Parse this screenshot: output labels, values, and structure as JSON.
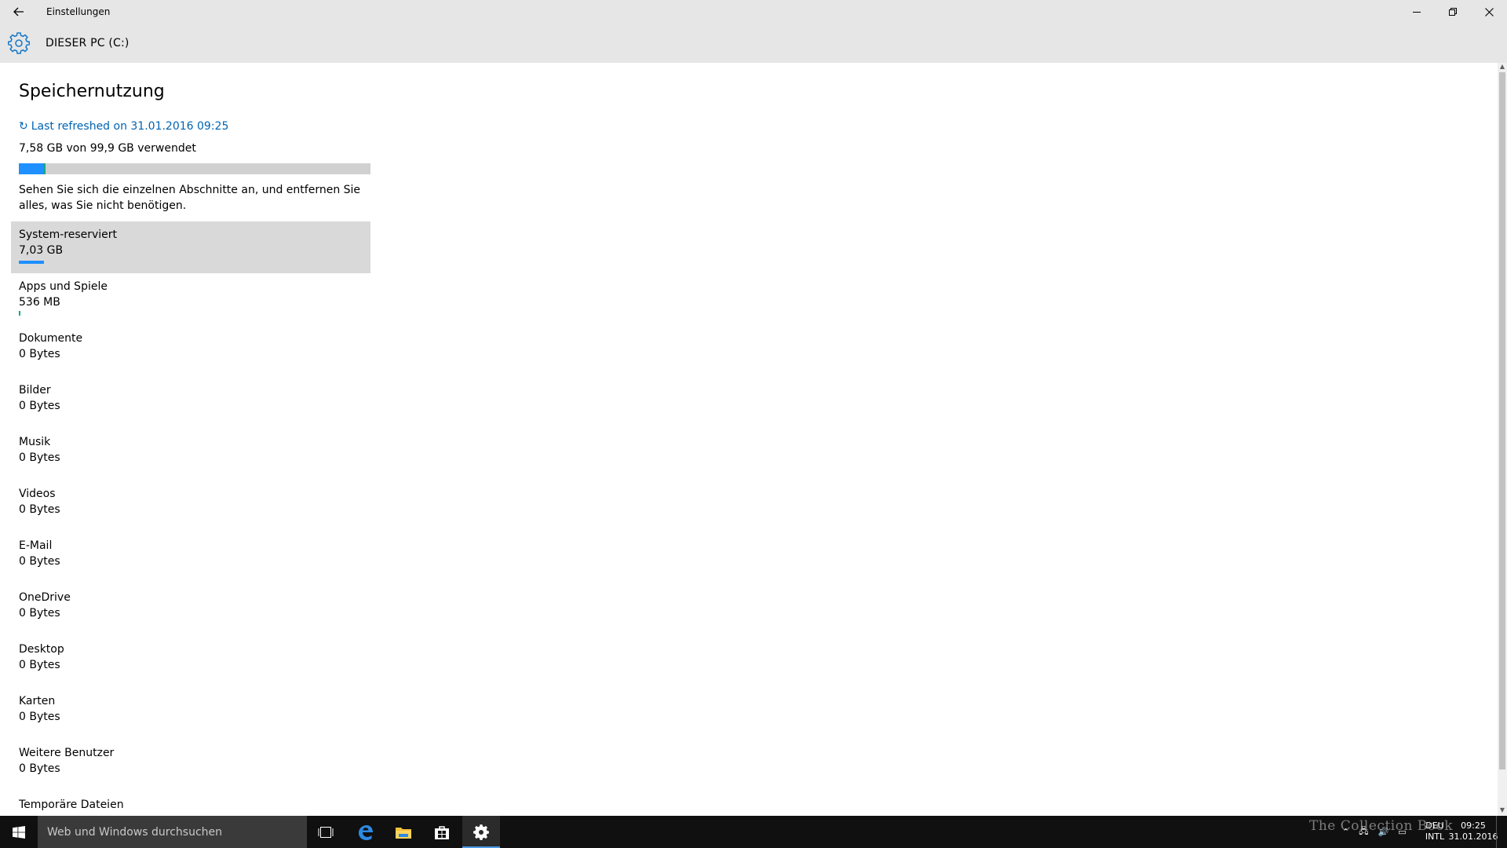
{
  "window": {
    "title": "Einstellungen",
    "back_icon": "back-arrow-icon",
    "minimize_glyph": "─",
    "restore_glyph": "❐",
    "close_glyph": "✕"
  },
  "header": {
    "title": "DIESER PC (C:)",
    "icon": "gear-icon"
  },
  "page": {
    "title": "Speichernutzung",
    "refresh_icon": "↻",
    "refresh_text": "Last refreshed on 31.01.2016 09:25",
    "usage_text": "7,58 GB von 99,9 GB verwendet",
    "usage": {
      "total_gb": 99.9,
      "system_gb": 7.03,
      "apps_gb": 0.536
    },
    "description": "Sehen Sie sich die einzelnen Abschnitte an, und entfernen Sie alles, was Sie nicht benötigen."
  },
  "categories": [
    {
      "name": "System-reserviert",
      "size": "7,03 GB"
    },
    {
      "name": "Apps und Spiele",
      "size": "536 MB"
    },
    {
      "name": "Dokumente",
      "size": "0 Bytes"
    },
    {
      "name": "Bilder",
      "size": "0 Bytes"
    },
    {
      "name": "Musik",
      "size": "0 Bytes"
    },
    {
      "name": "Videos",
      "size": "0 Bytes"
    },
    {
      "name": "E-Mail",
      "size": "0 Bytes"
    },
    {
      "name": "OneDrive",
      "size": "0 Bytes"
    },
    {
      "name": "Desktop",
      "size": "0 Bytes"
    },
    {
      "name": "Karten",
      "size": "0 Bytes"
    },
    {
      "name": "Weitere Benutzer",
      "size": "0 Bytes"
    },
    {
      "name": "Temporäre Dateien",
      "size": ""
    }
  ],
  "taskbar": {
    "search_placeholder": "Web und Windows durchsuchen",
    "language_top": "DEU",
    "language_bottom": "INTL",
    "time": "09:25",
    "date": "31.01.2016",
    "watermark": "The Collection Book"
  },
  "colors": {
    "accent": "#1e90ff",
    "link": "#0063b1",
    "apps": "#15a589"
  }
}
